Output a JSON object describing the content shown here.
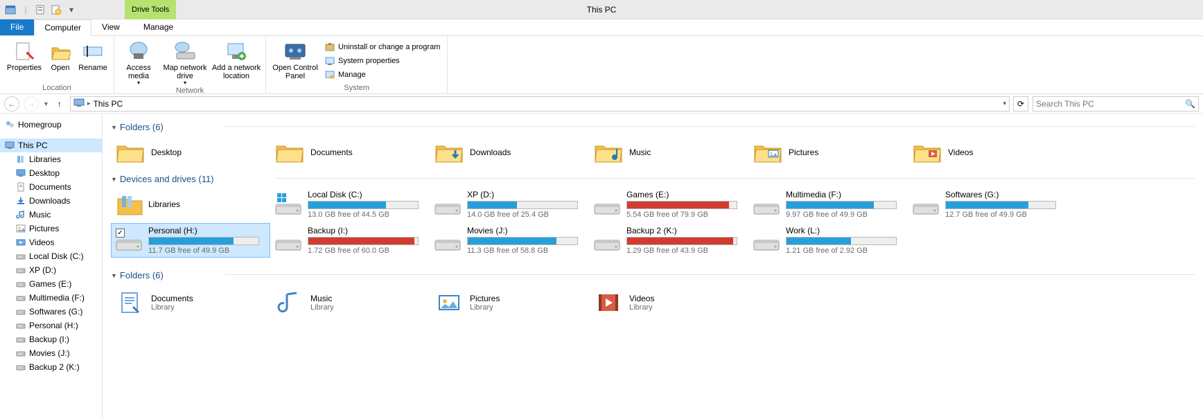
{
  "window": {
    "title": "This PC",
    "drive_tools": "Drive Tools"
  },
  "tabs": {
    "file": "File",
    "computer": "Computer",
    "view": "View",
    "manage": "Manage"
  },
  "ribbon": {
    "location": {
      "label": "Location",
      "properties": "Properties",
      "open": "Open",
      "rename": "Rename"
    },
    "network": {
      "label": "Network",
      "access": "Access media",
      "map": "Map network drive",
      "add": "Add a network location"
    },
    "system": {
      "label": "System",
      "panel": "Open Control Panel",
      "uninstall": "Uninstall or change a program",
      "props": "System properties",
      "manage": "Manage"
    }
  },
  "nav": {
    "breadcrumb": "This PC",
    "search_placeholder": "Search This PC"
  },
  "sidebar": {
    "homegroup": "Homegroup",
    "thispc": "This PC",
    "items": [
      "Libraries",
      "Desktop",
      "Documents",
      "Downloads",
      "Music",
      "Pictures",
      "Videos",
      "Local Disk (C:)",
      "XP (D:)",
      "Games (E:)",
      "Multimedia (F:)",
      "Softwares (G:)",
      "Personal (H:)",
      "Backup (I:)",
      "Movies (J:)",
      "Backup 2 (K:)"
    ]
  },
  "sections": {
    "folders_hdr": "Folders (6)",
    "drives_hdr": "Devices and drives (11)",
    "libs_hdr": "Folders (6)"
  },
  "folders": [
    {
      "name": "Desktop",
      "kind": "desktop"
    },
    {
      "name": "Documents",
      "kind": "documents"
    },
    {
      "name": "Downloads",
      "kind": "downloads"
    },
    {
      "name": "Music",
      "kind": "music"
    },
    {
      "name": "Pictures",
      "kind": "pictures"
    },
    {
      "name": "Videos",
      "kind": "videos"
    }
  ],
  "drives": [
    {
      "name": "Libraries",
      "free": "",
      "pct": null,
      "color": "",
      "kind": "lib"
    },
    {
      "name": "Local Disk (C:)",
      "free": "13.0 GB free of 44.5 GB",
      "pct": 71,
      "color": "blue",
      "kind": "os"
    },
    {
      "name": "XP (D:)",
      "free": "14.0 GB free of 25.4 GB",
      "pct": 45,
      "color": "blue",
      "kind": "hd"
    },
    {
      "name": "Games (E:)",
      "free": "5.54 GB free of 79.9 GB",
      "pct": 93,
      "color": "red",
      "kind": "hd"
    },
    {
      "name": "Multimedia (F:)",
      "free": "9.97 GB free of 49.9 GB",
      "pct": 80,
      "color": "blue",
      "kind": "hd"
    },
    {
      "name": "Softwares (G:)",
      "free": "12.7 GB free of 49.9 GB",
      "pct": 75,
      "color": "blue",
      "kind": "hd"
    },
    {
      "name": "Personal (H:)",
      "free": "11.7 GB free of 49.9 GB",
      "pct": 77,
      "color": "blue",
      "kind": "hd",
      "selected": true
    },
    {
      "name": "Backup (I:)",
      "free": "1.72 GB free of 60.0 GB",
      "pct": 97,
      "color": "red",
      "kind": "hd"
    },
    {
      "name": "Movies (J:)",
      "free": "11.3 GB free of 58.8 GB",
      "pct": 81,
      "color": "blue",
      "kind": "hd"
    },
    {
      "name": "Backup 2 (K:)",
      "free": "1.29 GB free of 43.9 GB",
      "pct": 97,
      "color": "red",
      "kind": "hd"
    },
    {
      "name": "Work (L:)",
      "free": "1.21 GB free of 2.92 GB",
      "pct": 59,
      "color": "blue",
      "kind": "hd"
    }
  ],
  "libs": [
    {
      "name": "Documents",
      "sub": "Library",
      "kind": "documents"
    },
    {
      "name": "Music",
      "sub": "Library",
      "kind": "music"
    },
    {
      "name": "Pictures",
      "sub": "Library",
      "kind": "pictures"
    },
    {
      "name": "Videos",
      "sub": "Library",
      "kind": "videos"
    }
  ]
}
